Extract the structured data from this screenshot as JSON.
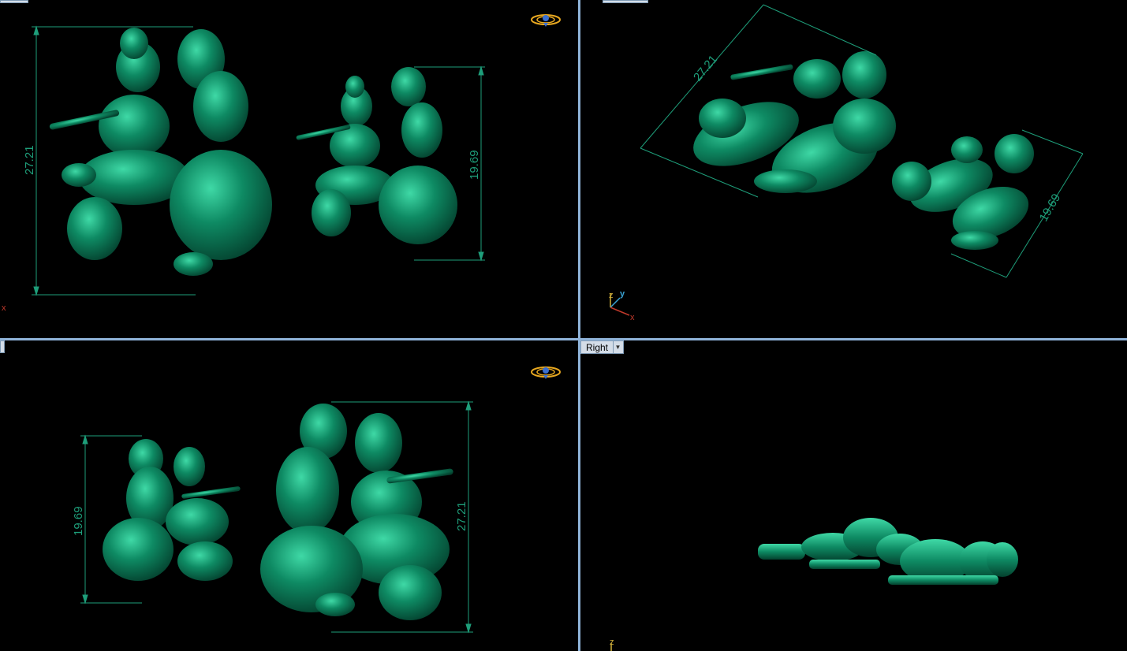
{
  "viewports": {
    "top_left": {
      "dim_large": "27.21",
      "dim_small": "19.69",
      "axis_x": "x"
    },
    "top_right": {
      "dim_large": "27.21",
      "dim_small": "19.69",
      "axis_x": "x",
      "axis_y": "y",
      "axis_z": "z"
    },
    "bottom_left": {
      "dim_large": "27.21",
      "dim_small": "19.69"
    },
    "bottom_right": {
      "label": "Right",
      "axis_z": "z"
    }
  },
  "colors": {
    "model": "#0d7a5a",
    "dimension": "#1e9e7a",
    "divider": "#8fb3d9",
    "background": "#000000"
  }
}
